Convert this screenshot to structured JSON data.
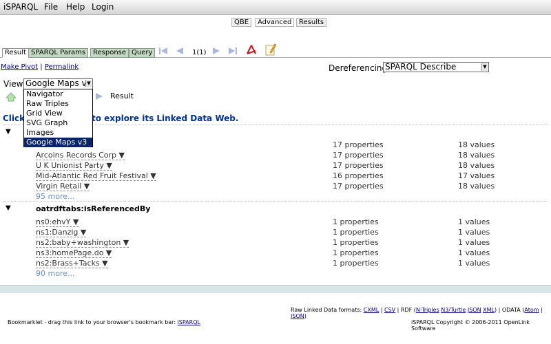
{
  "menubar": {
    "app": "iSPARQL",
    "file": "File",
    "help": "Help",
    "login": "Login"
  },
  "top_tabs": [
    "QBE",
    "Advanced",
    "Results"
  ],
  "sub_tabs": [
    "Result",
    "SPARQL Params",
    "Response",
    "Query"
  ],
  "pager": {
    "counter": "1(1)"
  },
  "links": {
    "make_pivot": "Make Pivot",
    "separator": "|",
    "permalink": "Permalink"
  },
  "dereferencing": {
    "label": "Dereferencing:",
    "value": "SPARQL Describe"
  },
  "view": {
    "label": "View:",
    "value": "Google Maps v3",
    "options": [
      "Navigator",
      "Raw Triples",
      "Grid View",
      "SVG Graph",
      "Images",
      "Google Maps v3"
    ]
  },
  "crumb": "Result",
  "headline_left": "Click",
  "headline_right": "to explore its Linked Data Web.",
  "section1": {
    "rows": [
      {
        "name": "",
        "props": "17 properties",
        "vals": "18 values"
      },
      {
        "name": "Arcoins Records Corp",
        "props": "17 properties",
        "vals": "18 values"
      },
      {
        "name": "U K Unionist Party",
        "props": "17 properties",
        "vals": "18 values"
      },
      {
        "name": "Mid-Atlantic Red Fruit Festival",
        "props": "16 properties",
        "vals": "17 values"
      },
      {
        "name": "Virgin Retail",
        "props": "17 properties",
        "vals": "18 values"
      }
    ],
    "more": "95 more..."
  },
  "section2": {
    "title": "oatrdftabs:isReferencedBy",
    "rows": [
      {
        "name": "ns0:ehvY",
        "props": "1 properties",
        "vals": "1 values"
      },
      {
        "name": "ns1:Danzig",
        "props": "1 properties",
        "vals": "1 values"
      },
      {
        "name": "ns2:baby+washington",
        "props": "1 properties",
        "vals": "1 values"
      },
      {
        "name": "ns3:homePage.do",
        "props": "1 properties",
        "vals": "1 values"
      },
      {
        "name": "ns2:Brass+Tacks",
        "props": "1 properties",
        "vals": "1 values"
      }
    ],
    "more": "90 more..."
  },
  "footer": {
    "raw_label": "Raw Linked Data formats:",
    "cxml": "CXML",
    "csv": "CSV",
    "rdf_label": "RDF (",
    "ntriples": "N-Triples",
    "n3turtle": "N3/Turtle",
    "json": "JSON",
    "xml": "XML",
    "odata_label": ") | ODATA (",
    "atom": "Atom",
    "json2": "JSON",
    "close": ")",
    "bookmarklet": "Bookmarklet - drag this link to your browser's bookmark bar:",
    "bookmarklet_link": "iSPARQL",
    "copyright": "iSPARQL Copyright © 2006-2011 OpenLink Software"
  }
}
